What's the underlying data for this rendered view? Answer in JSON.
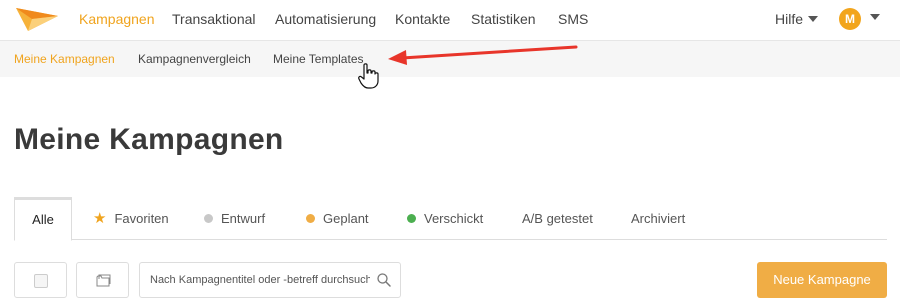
{
  "header": {
    "nav": [
      {
        "label": "Kampagnen",
        "active": true
      },
      {
        "label": "Transaktional"
      },
      {
        "label": "Automatisierung"
      },
      {
        "label": "Kontakte"
      },
      {
        "label": "Statistiken"
      },
      {
        "label": "SMS"
      }
    ],
    "help_label": "Hilfe",
    "avatar_initial": "M"
  },
  "subnav": [
    {
      "label": "Meine Kampagnen",
      "active": true
    },
    {
      "label": "Kampagnenvergleich"
    },
    {
      "label": "Meine Templates"
    }
  ],
  "page_title": "Meine Kampagnen",
  "tabs": [
    {
      "label": "Alle",
      "active": true
    },
    {
      "label": "Favoriten",
      "icon": "star-icon",
      "color": "#f0a41e"
    },
    {
      "label": "Entwurf",
      "icon": "dot",
      "color": "#c8c8c8"
    },
    {
      "label": "Geplant",
      "icon": "dot",
      "color": "#f0ad45"
    },
    {
      "label": "Verschickt",
      "icon": "dot",
      "color": "#4caf50"
    },
    {
      "label": "A/B getestet"
    },
    {
      "label": "Archiviert"
    }
  ],
  "toolbar": {
    "search_placeholder": "Nach Kampagnentitel oder -betreff durchsuchen",
    "new_campaign_label": "Neue Kampagne"
  },
  "colors": {
    "accent": "#f0a41e",
    "button": "#f0ad45",
    "annotation_arrow": "#e8352a"
  }
}
